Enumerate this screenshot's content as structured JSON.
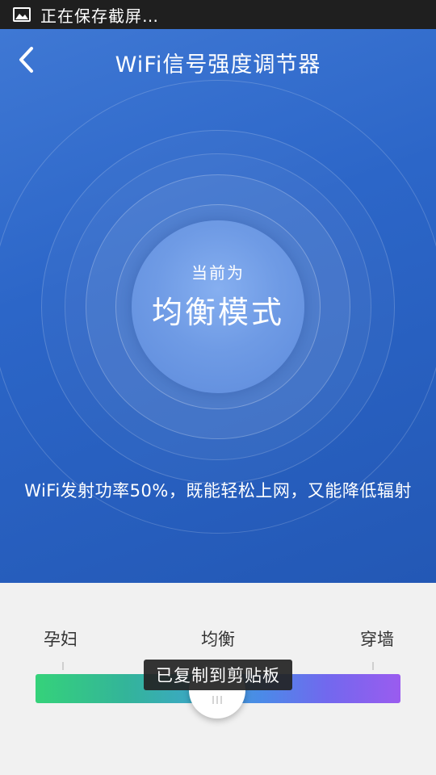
{
  "status_bar": {
    "icon": "gallery-icon",
    "text": "正在保存截屏…"
  },
  "header": {
    "back_icon": "chevron-left-icon",
    "title": "WiFi信号强度调节器"
  },
  "mode": {
    "caption": "当前为",
    "value": "均衡模式",
    "description": "WiFi发射功率50%，既能轻松上网，又能降低辐射"
  },
  "slider": {
    "labels": [
      "孕妇",
      "均衡",
      "穿墙"
    ],
    "selected_index": 1,
    "value_percent": 50,
    "gradient_colors": [
      "#35d27a",
      "#4b8ae8",
      "#9a5cef"
    ]
  },
  "toast": {
    "text": "已复制到剪贴板"
  },
  "colors": {
    "hero_blue": "#2c66c8",
    "status_bar_bg": "#1f1f1f",
    "panel_bg": "#f1f1f1"
  }
}
